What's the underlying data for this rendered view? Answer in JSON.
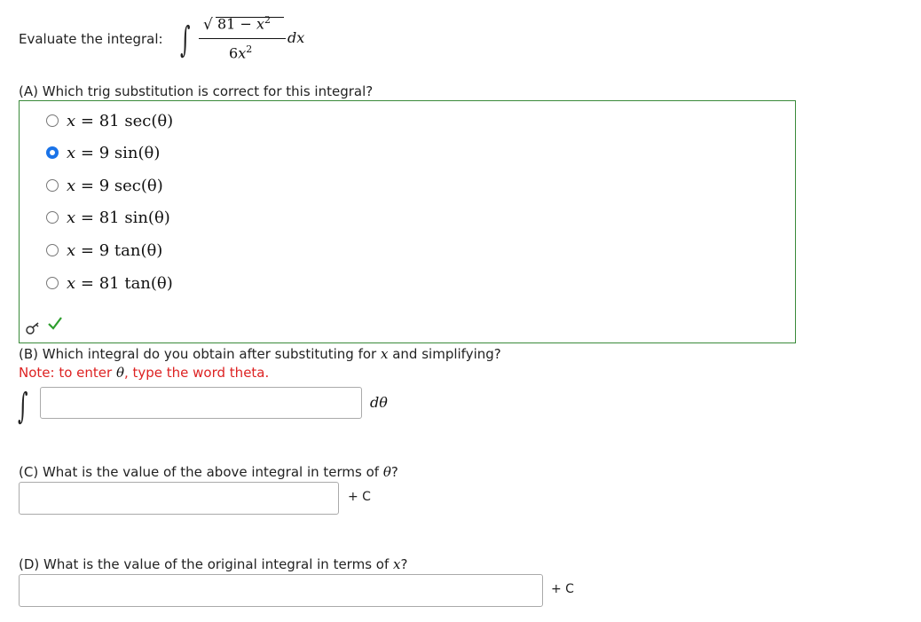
{
  "prompt": "Evaluate the integral:",
  "integral": {
    "sign": "∫",
    "numerator_const": "81",
    "numerator_minus": "−",
    "numerator_var": "x",
    "numerator_exp": "2",
    "denominator_coef": "6",
    "denominator_var": "x",
    "denominator_exp": "2",
    "differential": "dx"
  },
  "partA": {
    "question": "(A) Which trig substitution is correct for this integral?",
    "options": [
      {
        "lhs": "x",
        "eq": "=",
        "rhs": "81 sec(θ)",
        "selected": false
      },
      {
        "lhs": "x",
        "eq": "=",
        "rhs": "9 sin(θ)",
        "selected": true
      },
      {
        "lhs": "x",
        "eq": "=",
        "rhs": "9 sec(θ)",
        "selected": false
      },
      {
        "lhs": "x",
        "eq": "=",
        "rhs": "81 sin(θ)",
        "selected": false
      },
      {
        "lhs": "x",
        "eq": "=",
        "rhs": "9 tan(θ)",
        "selected": false
      },
      {
        "lhs": "x",
        "eq": "=",
        "rhs": "81 tan(θ)",
        "selected": false
      }
    ],
    "status_icon": "check-icon",
    "status_color": "#2e9e2e",
    "border_color": "#3a8a3a"
  },
  "partB": {
    "question_pre": "(B) Which integral do you obtain after substituting for ",
    "question_var": "x",
    "question_post": " and simplifying?",
    "note_pre": "Note: to enter ",
    "note_sym": "θ",
    "note_post": ", type the word theta.",
    "note_color": "#dd2222",
    "integral_sign": "∫",
    "input_value": "",
    "differential": "dθ"
  },
  "partC": {
    "question_pre": "(C) What is the value of the above integral in terms of ",
    "question_sym": "θ",
    "question_post": "?",
    "input_value": "",
    "plus_c": "+ C"
  },
  "partD": {
    "question_pre": "(D) What is the value of the original integral in terms of ",
    "question_var": "x",
    "question_post": "?",
    "input_value": "",
    "plus_c": "+ C"
  }
}
